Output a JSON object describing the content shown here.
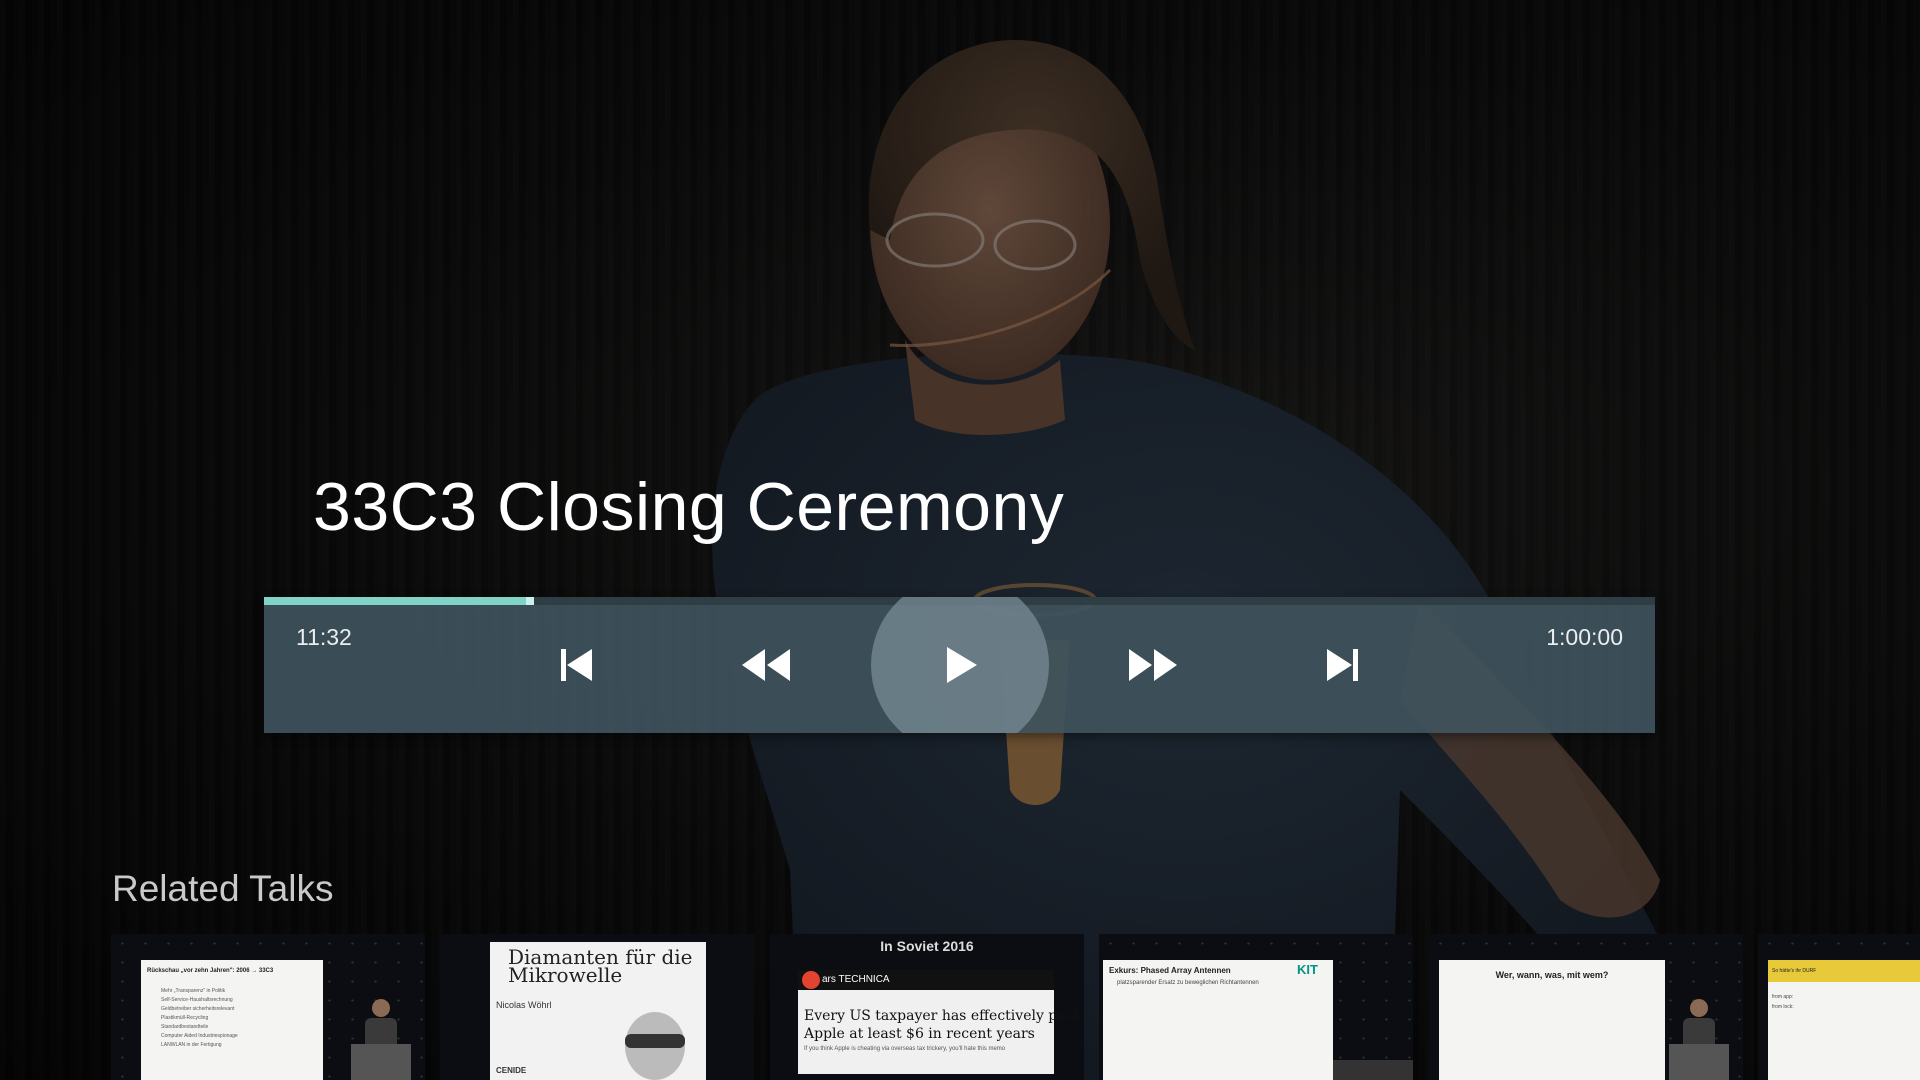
{
  "video": {
    "title": "33C3 Closing Ceremony",
    "progress": 0.191
  },
  "controls": {
    "current_time": "11:32",
    "total_time": "1:00:00",
    "buttons": [
      {
        "id": "skip-previous",
        "icon": "skip-previous-icon"
      },
      {
        "id": "rewind",
        "icon": "rewind-icon"
      },
      {
        "id": "play",
        "icon": "play-icon"
      },
      {
        "id": "fast-forward",
        "icon": "fast-forward-icon"
      },
      {
        "id": "skip-next",
        "icon": "skip-next-icon"
      }
    ]
  },
  "related": {
    "heading": "Related Talks",
    "items": [
      {
        "slide_title": "Rückschau „vor zehn Jahren\": 2006 → 33C3",
        "bullets": [
          "Mehr „Transparenz\" in Politik",
          "Self-Service-Haushaltsrechnung",
          "Geldbetreiber sicherheitsrelevant",
          "Plastikmüll-Recycling",
          "Standardbestandteile",
          "Computer Aided Industriespionage",
          "LANWLAN in der Fertigung"
        ]
      },
      {
        "slide_title": "Diamanten für die Mikrowelle",
        "presenter": "Nicolas Wöhrl",
        "logo": "CENIDE"
      },
      {
        "slide_title": "In Soviet 2016",
        "brand": "ars TECHNICA",
        "headline_1": "Every US taxpayer has effectively paid",
        "headline_2": "Apple at least $6 in recent years",
        "subtext": "If you think Apple is cheating via overseas tax trickery, you'll hate this memo"
      },
      {
        "slide_title": "Exkurs: Phased Array Antennen",
        "bullet": "platzsparender Ersatz zu beweglichen Richtantennen",
        "logo": "KIT"
      },
      {
        "slide_title": "Wer, wann, was, mit wem?"
      },
      {
        "slide_title": "So hätte's ihr DURF",
        "lines": [
          "from app:",
          "from lock:"
        ]
      }
    ]
  },
  "colors": {
    "accent": "#7fd3c7",
    "control_bar": "#3f525c"
  }
}
